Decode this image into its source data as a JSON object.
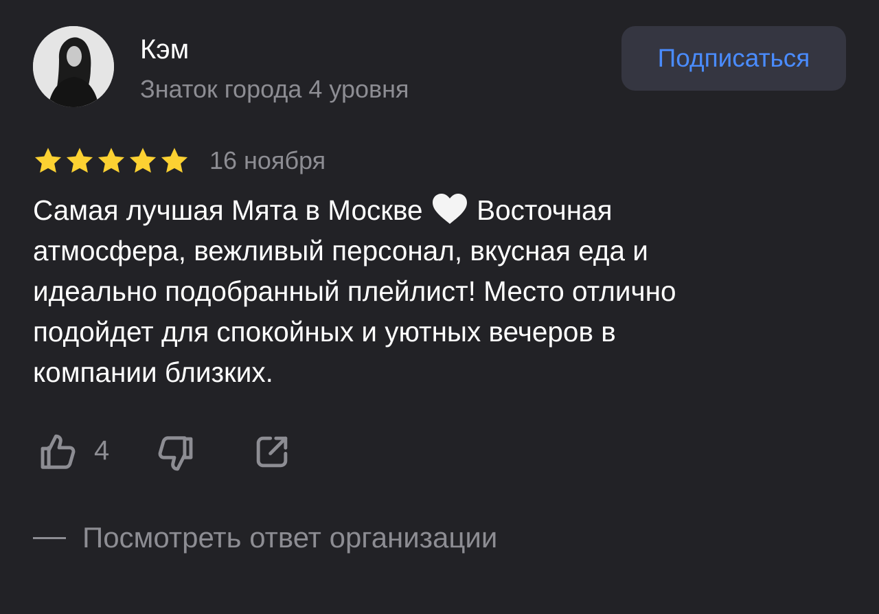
{
  "review": {
    "author": {
      "name": "Кэм",
      "level": "Знаток города 4 уровня",
      "avatar_icon": "user-photo-avatar"
    },
    "subscribe_label": "Подписаться",
    "rating": 5,
    "rating_max": 5,
    "date": "16 ноября",
    "text_lines": [
      "Самая лучшая Мята в Москве",
      "Восточная",
      "атмосфера, вежливый персонал, вкусная еда и",
      "идеально подобранный плейлист! Место отлично",
      "подойдет для спокойных и уютных вечеров в",
      "компании близких."
    ],
    "emoji": "white-heart-icon",
    "actions": {
      "like_icon": "thumbs-up-icon",
      "like_count": "4",
      "dislike_icon": "thumbs-down-icon",
      "share_icon": "share-icon"
    },
    "org_reply_label": "Посмотреть ответ организации"
  },
  "colors": {
    "background": "#222226",
    "primary_text": "#ffffff",
    "secondary_text": "#8d8d93",
    "accent": "#4a8cff",
    "button_bg": "#353641",
    "star": "#fcd132"
  }
}
